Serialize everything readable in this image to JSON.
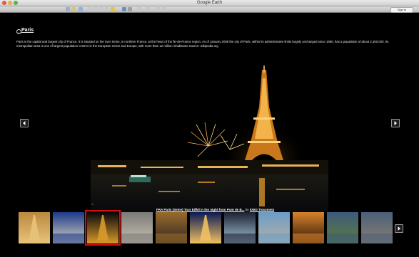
{
  "window": {
    "title": "Google Earth",
    "sign_in_label": "Sign in"
  },
  "place": {
    "title": "Paris",
    "description": "Paris is the capital and largest city of France. It is situated on the river Seine, in northern France, at the heart of the Île-de-France region. As of January 2008 the city of Paris, within its administrative limits largely unchanged since 1860, has a population of about 2,300,000. Its metropolitan area is one of largest population centres in the European Union and Europe, with more than 12 million inhabitants Source: wikipedia.org"
  },
  "photo": {
    "caption_link": "FRA Paris (Seine) Tour Eiffel in the night from Pont de B...",
    "caption_by": " by ",
    "caption_author": "KWO Tissomets"
  },
  "thumbnails": [
    {
      "icon": "eiffel-tower-day-photo",
      "selected": false,
      "colors": [
        "#b98a3e",
        "#e9c27a"
      ]
    },
    {
      "icon": "sacre-coeur-photo",
      "selected": false,
      "colors": [
        "#1c3a8a",
        "#d9d3c0"
      ]
    },
    {
      "icon": "eiffel-tower-night-photo",
      "selected": true,
      "colors": [
        "#06060a",
        "#d89a2a"
      ]
    },
    {
      "icon": "street-photo",
      "selected": false,
      "colors": [
        "#7b7a76",
        "#c7c2b5"
      ]
    },
    {
      "icon": "skyline-sunset-photo",
      "selected": false,
      "colors": [
        "#9a6a2c",
        "#2f2a24"
      ]
    },
    {
      "icon": "tower-night-blue-photo",
      "selected": false,
      "colors": [
        "#0b1a55",
        "#f0c060"
      ]
    },
    {
      "icon": "louvre-pyramid-photo",
      "selected": false,
      "colors": [
        "#1a2230",
        "#a8c4dc"
      ]
    },
    {
      "icon": "bridge-photo",
      "selected": false,
      "colors": [
        "#6a9cc8",
        "#b7b1a2"
      ]
    },
    {
      "icon": "city-lights-photo",
      "selected": false,
      "colors": [
        "#d9822b",
        "#2a1808"
      ]
    },
    {
      "icon": "garden-photo",
      "selected": false,
      "colors": [
        "#3c5a7c",
        "#5e7d3a"
      ]
    },
    {
      "icon": "notre-dame-photo",
      "selected": false,
      "colors": [
        "#4a5f7a",
        "#8a8070"
      ]
    }
  ]
}
